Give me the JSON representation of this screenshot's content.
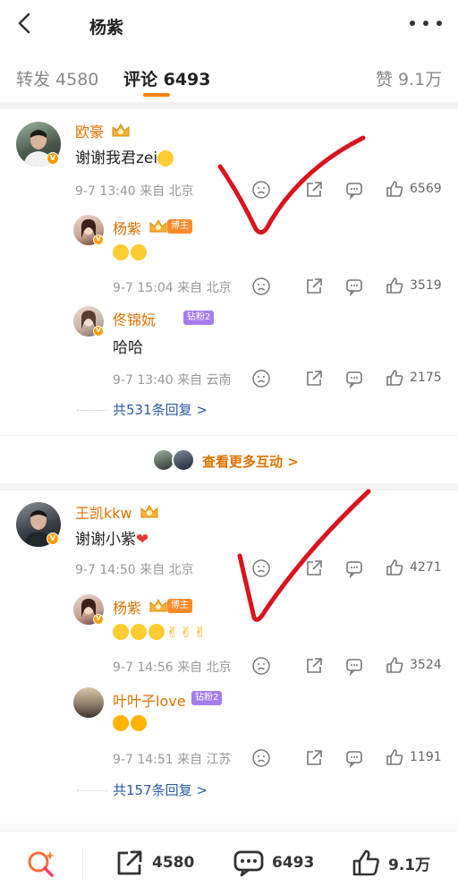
{
  "header": {
    "title": "杨紫"
  },
  "tabs": [
    {
      "label": "转发 4580"
    },
    {
      "label": "评论 6493"
    },
    {
      "label": "赞 9.1万"
    }
  ],
  "comments": [
    {
      "name": "欧豪",
      "text": "谢谢我君zei",
      "meta": "9-7 13:40  来自 北京",
      "likes": "6569",
      "replies": [
        {
          "name": "杨紫",
          "tag": "博主",
          "text": "",
          "meta": "9-7 15:04  来自 北京",
          "likes": "3519"
        },
        {
          "name": "佟锦妧",
          "tag": "钻粉2",
          "text": "哈哈",
          "meta": "9-7 13:40  来自 云南",
          "likes": "2175"
        }
      ],
      "reply_summary": "共531条回复 >"
    },
    {
      "name": "王凯kkw",
      "text": "谢谢小紫",
      "meta": "9-7 14:50  来自 北京",
      "likes": "4271",
      "replies": [
        {
          "name": "杨紫",
          "tag": "博主",
          "text": "",
          "meta": "9-7 14:56  来自 北京",
          "likes": "3524"
        },
        {
          "name": "叶叶子love",
          "tag": "钻粉2",
          "text": "",
          "meta": "9-7 14:51  来自 江苏",
          "likes": "1191"
        }
      ],
      "reply_summary": "共157条回复 >"
    }
  ],
  "more_interactions": "查看更多互动 >",
  "bottom_bar": {
    "share_count": "4580",
    "comment_count": "6493",
    "like_count": "9.1万"
  },
  "colors": {
    "accent": "#ff8200",
    "name": "#e07200",
    "link": "#2a5aa8",
    "checkmark": "#d8141e"
  }
}
